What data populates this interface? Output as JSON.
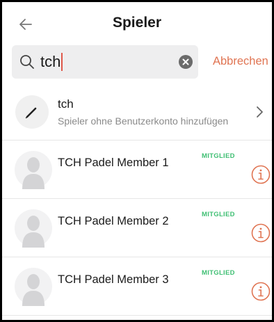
{
  "header": {
    "title": "Spieler",
    "back_icon": "arrow-left-icon"
  },
  "search": {
    "value": "tch",
    "search_icon": "search-icon",
    "clear_icon": "clear-circle-icon",
    "cancel_label": "Abbrechen"
  },
  "add_guest": {
    "icon": "pencil-icon",
    "title": "tch",
    "subtitle": "Spieler ohne Benutzerkonto hinzufügen",
    "chevron_icon": "chevron-right-icon"
  },
  "players": [
    {
      "name": "TCH Padel Member 1",
      "badge": "MITGLIED"
    },
    {
      "name": "TCH Padel Member 2",
      "badge": "MITGLIED"
    },
    {
      "name": "TCH Padel Member 3",
      "badge": "MITGLIED"
    }
  ],
  "colors": {
    "accent": "#e07452",
    "member_badge": "#3fbf73",
    "caret": "#e0584a",
    "search_bg": "#eeeeef"
  }
}
